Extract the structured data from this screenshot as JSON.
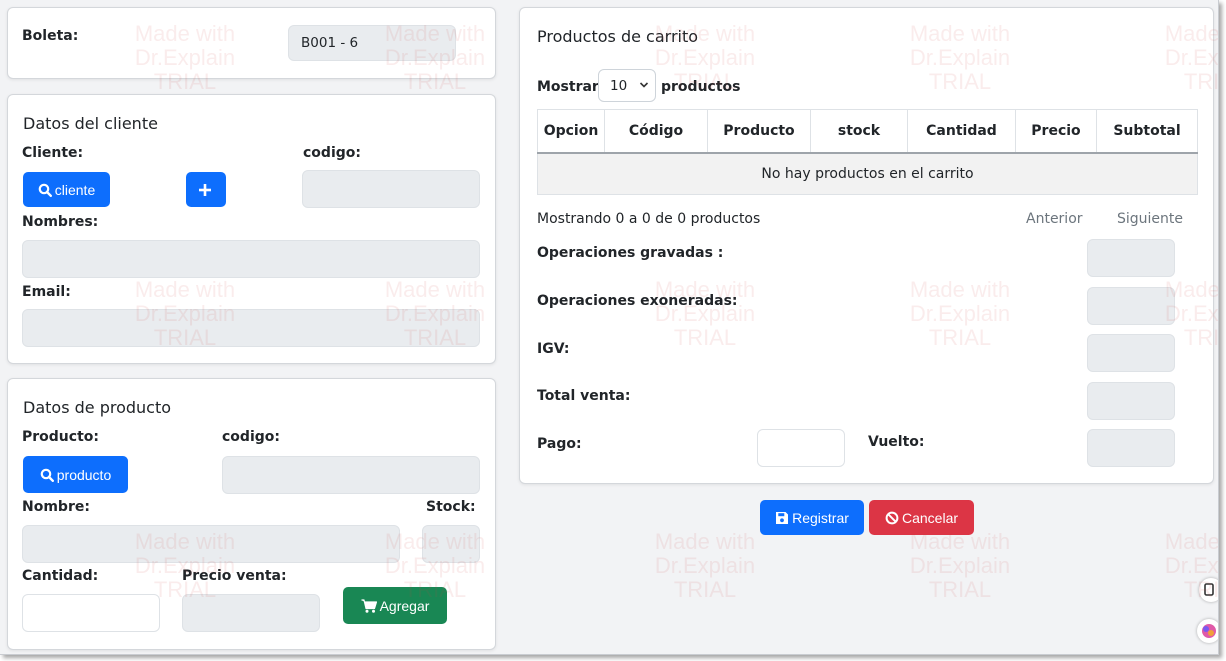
{
  "boleta": {
    "label": "Boleta:",
    "value": "B001 - 6"
  },
  "cliente": {
    "title": "Datos del cliente",
    "cliente_label": "Cliente:",
    "codigo_label": "codigo:",
    "search_button": "cliente",
    "nombres_label": "Nombres:",
    "email_label": "Email:"
  },
  "producto": {
    "title": "Datos de producto",
    "producto_label": "Producto:",
    "codigo_label": "codigo:",
    "search_button": "producto",
    "nombre_label": "Nombre:",
    "stock_label": "Stock:",
    "cantidad_label": "Cantidad:",
    "precio_label": "Precio venta:",
    "add_button": "Agregar"
  },
  "carrito": {
    "title": "Productos de carrito",
    "show_prefix": "Mostrar",
    "page_size": "10",
    "show_suffix": "productos",
    "columns": [
      "Opcion",
      "Código",
      "Producto",
      "stock",
      "Cantidad",
      "Precio",
      "Subtotal"
    ],
    "empty_message": "No hay productos en el carrito",
    "info": "Mostrando 0 a 0 de 0 productos",
    "prev": "Anterior",
    "next": "Siguiente",
    "gravadas_label": "Operaciones gravadas :",
    "exoneradas_label": "Operaciones exoneradas:",
    "igv_label": "IGV:",
    "total_label": "Total venta:",
    "pago_label": "Pago:",
    "vuelto_label": "Vuelto:"
  },
  "actions": {
    "register": "Registrar",
    "cancel": "Cancelar"
  },
  "watermark": {
    "line1": "Made with",
    "line2": "Dr.Explain",
    "line3": "TRIAL"
  },
  "colors": {
    "primary": "#0d6efd",
    "success": "#198754",
    "danger": "#dc3545",
    "input_bg": "#e9ecef",
    "page_bg": "#f2f3f5"
  }
}
